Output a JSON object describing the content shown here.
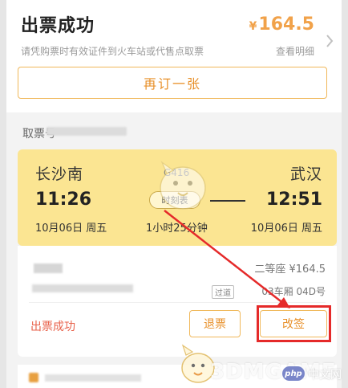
{
  "header": {
    "status_title": "出票成功",
    "price_symbol": "¥",
    "price_value": "164.5",
    "hint": "请凭购票时有效证件到火车站或代售点取票",
    "detail_link": "查看明细",
    "rebook_label": "再订一张"
  },
  "ticket": {
    "pickup_label": "取票号",
    "from_station": "长沙南",
    "to_station": "武汉",
    "train_no": "G416",
    "depart_time": "11:26",
    "arrive_time": "12:51",
    "timetable_label": "时刻表",
    "depart_date": "10月06日 周五",
    "arrive_date": "10月06日 周五",
    "duration": "1小时25分钟"
  },
  "passenger": {
    "seat_class": "二等座 ¥164.5",
    "checkin_tag": "过道",
    "seat_no": "03车厢 04D号",
    "status": "出票成功",
    "refund_label": "退票",
    "change_label": "改签"
  },
  "watermark": {
    "brand": "3DMGAME",
    "badge": "php",
    "site_cn": "中文网"
  },
  "colors": {
    "accent": "#e8902a",
    "train_card_bg": "#fbe592",
    "status_red": "#e8624b",
    "highlight": "#e52a2a"
  }
}
